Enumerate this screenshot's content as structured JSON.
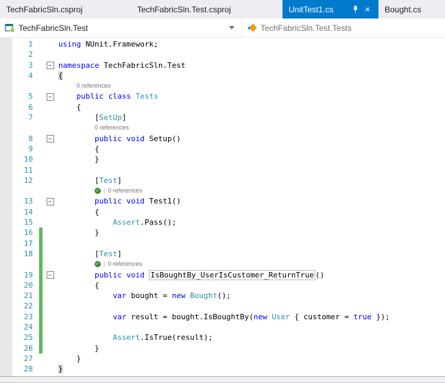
{
  "tabs": [
    {
      "label": "TechFabricSln.csproj",
      "active": false
    },
    {
      "label": "TechFabricSln.Test.csproj",
      "active": false
    },
    {
      "label": "UnitTest1.cs",
      "active": true,
      "pinned": true,
      "closable": true
    },
    {
      "label": "Bought.cs",
      "active": false
    }
  ],
  "navbar": {
    "project": "TechFabricSln.Test",
    "type": "TechFabricSln.Test.Tests"
  },
  "colors": {
    "accent": "#007acc",
    "tabbar_bg": "#eeeef2",
    "keyword": "#0000ff",
    "type_name": "#2b91af",
    "line_number": "#2b91af",
    "codelens_text": "#767676",
    "change_bar": "#5cb85c",
    "test_pass_green": "#388a34"
  },
  "editor": {
    "rows": [
      {
        "n": 1,
        "tokens": [
          {
            "t": "using",
            "c": "k"
          },
          {
            "t": " NUnit.Framework;",
            "c": "d"
          }
        ]
      },
      {
        "n": 2,
        "tokens": []
      },
      {
        "n": 3,
        "fold": true,
        "tokens": [
          {
            "t": "namespace",
            "c": "k"
          },
          {
            "t": " TechFabricSln.Test",
            "c": "d"
          }
        ]
      },
      {
        "n": 4,
        "tokens": [
          {
            "t": "{",
            "c": "hl"
          }
        ]
      },
      {
        "lens": {
          "label": "0 references",
          "check": false,
          "indent": 4
        }
      },
      {
        "n": 5,
        "fold": true,
        "tokens": [
          {
            "t": "    ",
            "c": "d"
          },
          {
            "t": "public",
            "c": "k"
          },
          {
            "t": " ",
            "c": "d"
          },
          {
            "t": "class",
            "c": "k"
          },
          {
            "t": " ",
            "c": "d"
          },
          {
            "t": "Tests",
            "c": "t"
          }
        ]
      },
      {
        "n": 6,
        "tokens": [
          {
            "t": "    {",
            "c": "d"
          }
        ]
      },
      {
        "n": 7,
        "tokens": [
          {
            "t": "        [",
            "c": "d"
          },
          {
            "t": "SetUp",
            "c": "t"
          },
          {
            "t": "]",
            "c": "d"
          }
        ]
      },
      {
        "lens": {
          "label": "0 references",
          "check": false,
          "indent": 8
        }
      },
      {
        "n": 8,
        "fold": true,
        "tokens": [
          {
            "t": "        ",
            "c": "d"
          },
          {
            "t": "public",
            "c": "k"
          },
          {
            "t": " ",
            "c": "d"
          },
          {
            "t": "void",
            "c": "k"
          },
          {
            "t": " Setup()",
            "c": "d"
          }
        ]
      },
      {
        "n": 9,
        "tokens": [
          {
            "t": "        {",
            "c": "d"
          }
        ]
      },
      {
        "n": 10,
        "tokens": [
          {
            "t": "        }",
            "c": "d"
          }
        ]
      },
      {
        "n": 11,
        "tokens": []
      },
      {
        "n": 12,
        "tokens": [
          {
            "t": "        [",
            "c": "d"
          },
          {
            "t": "Test",
            "c": "t"
          },
          {
            "t": "]",
            "c": "d"
          }
        ]
      },
      {
        "lens": {
          "label": "0 references",
          "check": true,
          "indent": 8
        }
      },
      {
        "n": 13,
        "fold": true,
        "tokens": [
          {
            "t": "        ",
            "c": "d"
          },
          {
            "t": "public",
            "c": "k"
          },
          {
            "t": " ",
            "c": "d"
          },
          {
            "t": "void",
            "c": "k"
          },
          {
            "t": " Test1()",
            "c": "d"
          }
        ]
      },
      {
        "n": 14,
        "tokens": [
          {
            "t": "        {",
            "c": "d"
          }
        ]
      },
      {
        "n": 15,
        "tokens": [
          {
            "t": "            ",
            "c": "d"
          },
          {
            "t": "Assert",
            "c": "t"
          },
          {
            "t": ".Pass();",
            "c": "d"
          }
        ]
      },
      {
        "n": 16,
        "chg": true,
        "tokens": [
          {
            "t": "        }",
            "c": "d"
          }
        ]
      },
      {
        "n": 17,
        "chg": true,
        "tokens": []
      },
      {
        "n": 18,
        "chg": true,
        "tokens": [
          {
            "t": "        [",
            "c": "d"
          },
          {
            "t": "Test",
            "c": "t"
          },
          {
            "t": "]",
            "c": "d"
          }
        ]
      },
      {
        "chg": true,
        "lens": {
          "label": "0 references",
          "check": true,
          "indent": 8
        }
      },
      {
        "n": 19,
        "fold": true,
        "chg": true,
        "tokens": [
          {
            "t": "        ",
            "c": "d"
          },
          {
            "t": "public",
            "c": "k"
          },
          {
            "t": " ",
            "c": "d"
          },
          {
            "t": "void",
            "c": "k"
          },
          {
            "t": " ",
            "c": "d"
          },
          {
            "t": "IsBoughtBy_UserIsCustomer_ReturnTrue",
            "c": "box"
          },
          {
            "t": "()",
            "c": "d"
          }
        ]
      },
      {
        "n": 20,
        "chg": true,
        "tokens": [
          {
            "t": "        {",
            "c": "d"
          }
        ]
      },
      {
        "n": 21,
        "chg": true,
        "tokens": [
          {
            "t": "            ",
            "c": "d"
          },
          {
            "t": "var",
            "c": "k"
          },
          {
            "t": " bought = ",
            "c": "d"
          },
          {
            "t": "new",
            "c": "k"
          },
          {
            "t": " ",
            "c": "d"
          },
          {
            "t": "Bought",
            "c": "t"
          },
          {
            "t": "();",
            "c": "d"
          }
        ]
      },
      {
        "n": 22,
        "chg": true,
        "tokens": []
      },
      {
        "n": 23,
        "chg": true,
        "tokens": [
          {
            "t": "            ",
            "c": "d"
          },
          {
            "t": "var",
            "c": "k"
          },
          {
            "t": " result = bought.IsBoughtBy(",
            "c": "d"
          },
          {
            "t": "new",
            "c": "k"
          },
          {
            "t": " ",
            "c": "d"
          },
          {
            "t": "User",
            "c": "t"
          },
          {
            "t": " { customer = ",
            "c": "d"
          },
          {
            "t": "true",
            "c": "k"
          },
          {
            "t": " });",
            "c": "d"
          }
        ]
      },
      {
        "n": 24,
        "chg": true,
        "tokens": []
      },
      {
        "n": 25,
        "chg": true,
        "tokens": [
          {
            "t": "            ",
            "c": "d"
          },
          {
            "t": "Assert",
            "c": "t"
          },
          {
            "t": ".IsTrue(result);",
            "c": "d"
          }
        ]
      },
      {
        "n": 26,
        "chg": true,
        "tokens": [
          {
            "t": "        }",
            "c": "d"
          }
        ]
      },
      {
        "n": 27,
        "tokens": [
          {
            "t": "    }",
            "c": "d"
          }
        ]
      },
      {
        "n": 28,
        "tokens": [
          {
            "t": "}",
            "c": "hl"
          }
        ]
      }
    ]
  }
}
